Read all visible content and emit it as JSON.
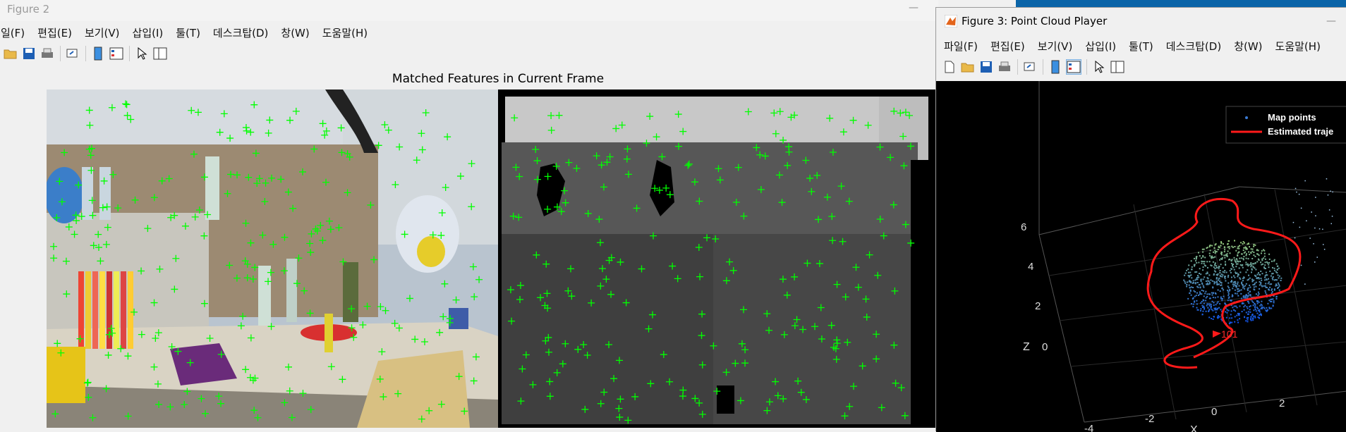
{
  "figure2": {
    "title": "Figure 2",
    "menu": [
      "일(F)",
      "편집(E)",
      "보기(V)",
      "삽입(I)",
      "툴(T)",
      "데스크탑(D)",
      "창(W)",
      "도움말(H)"
    ],
    "axes_title": "Matched Features in Current Frame"
  },
  "figure3": {
    "title": "Figure 3: Point Cloud Player",
    "menu": [
      "파일(F)",
      "편집(E)",
      "보기(V)",
      "삽입(I)",
      "툴(T)",
      "데스크탑(D)",
      "창(W)",
      "도움말(H)"
    ],
    "legend": [
      "Map points",
      "Estimated traje"
    ],
    "frame_label": "101",
    "z_axis_label": "Z",
    "x_axis_label": "X",
    "z_ticks": [
      "6",
      "4",
      "2",
      "0"
    ],
    "x_ticks": [
      "-4",
      "-2",
      "0",
      "2"
    ]
  },
  "icons": {
    "toolbar": [
      "open-folder-icon",
      "save-icon",
      "print-icon",
      "link-icon",
      "colorbar-icon",
      "legend-icon",
      "pointer-icon",
      "property-inspector-icon"
    ]
  },
  "colors": {
    "feature_marker": "#00ff00",
    "trajectory": "#ff0000",
    "map_points": "#3a7bd5"
  }
}
